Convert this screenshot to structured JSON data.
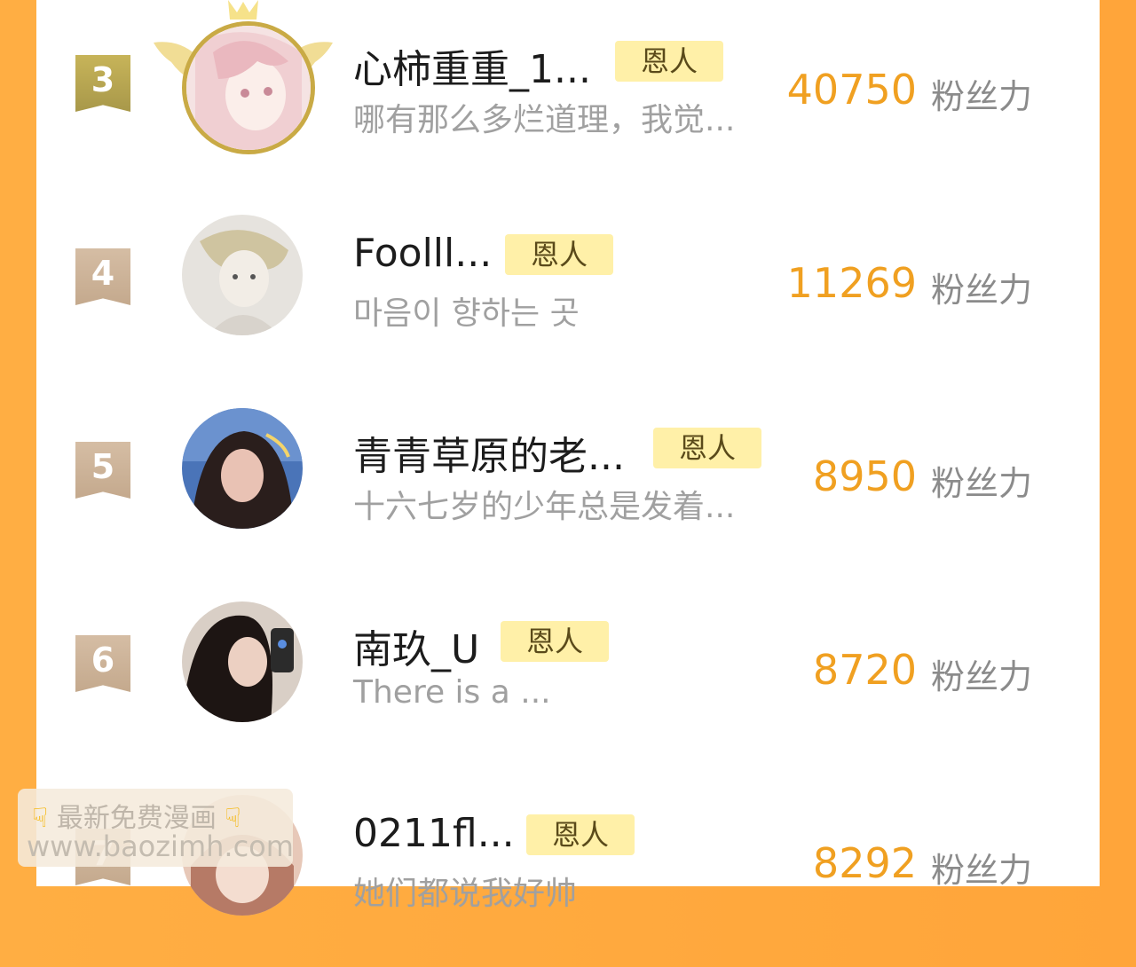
{
  "rows": [
    {
      "rank": "3",
      "name": "心柿重重_1...",
      "badge": "恩人",
      "bio": "哪有那么多烂道理，我觉...",
      "fans": "40750",
      "fans_label": "粉丝力"
    },
    {
      "rank": "4",
      "name": "Foolll...",
      "badge": "恩人",
      "bio": "마음이 향하는 곳",
      "fans": "11269",
      "fans_label": "粉丝力"
    },
    {
      "rank": "5",
      "name": "青青草原的老...",
      "badge": "恩人",
      "bio": "十六七岁的少年总是发着...",
      "fans": "8950",
      "fans_label": "粉丝力"
    },
    {
      "rank": "6",
      "name": "南玖_U",
      "badge": "恩人",
      "bio": "There is a ...",
      "fans": "8720",
      "fans_label": "粉丝力"
    },
    {
      "rank": "7",
      "name": "0211fl...",
      "badge": "恩人",
      "bio": "她们都说我好帅",
      "fans": "8292",
      "fans_label": "粉丝力"
    }
  ],
  "watermark": {
    "line1": "最新免费漫画",
    "line2": "www.baozimh.com"
  },
  "colors": {
    "accent": "#f0a021",
    "badge_bg": "#fff0a8",
    "border_orange": "#ffa53a"
  }
}
